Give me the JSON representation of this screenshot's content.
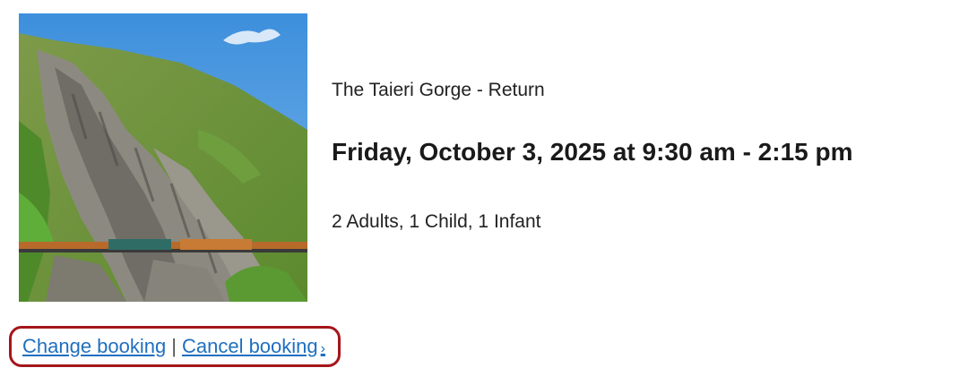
{
  "booking": {
    "image_subject": "Taieri Gorge train on rocky hillside",
    "trip_name": "The Taieri Gorge - Return",
    "datetime": "Friday, October 3, 2025 at 9:30 am - 2:15 pm",
    "guests": "2 Adults, 1 Child, 1 Infant"
  },
  "actions": {
    "change_label": "Change booking",
    "separator": "|",
    "cancel_label": "Cancel booking",
    "cancel_chevron": "›",
    "highlight_color": "#a4161a",
    "link_color": "#1f6fc0"
  }
}
